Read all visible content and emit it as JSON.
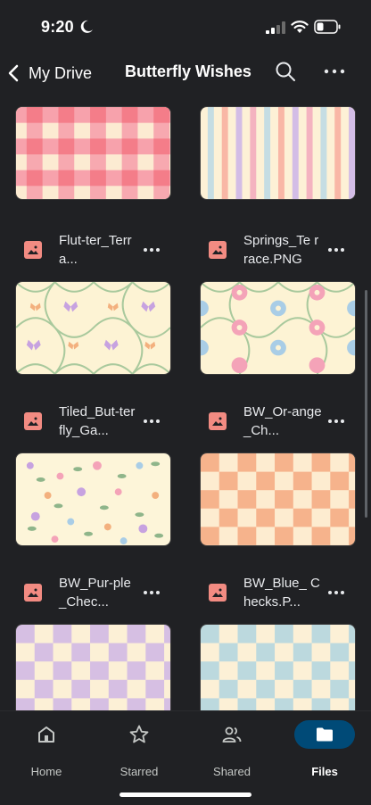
{
  "status": {
    "time": "9:20"
  },
  "header": {
    "back_label": "My Drive",
    "title": "Butterfly Wishes"
  },
  "files": [
    {
      "name": "",
      "pattern": "pink-gingham"
    },
    {
      "name": "",
      "pattern": "pastel-stripes"
    },
    {
      "name": "Flut-ter_Terra...",
      "pattern": "butterfly-trellis"
    },
    {
      "name": "Springs_Te rrace.PNG",
      "pattern": "flower-trellis"
    },
    {
      "name": "Tiled_But-terfly_Ga...",
      "pattern": "floral-scatter"
    },
    {
      "name": "BW_Or-ange_Ch...",
      "pattern": "orange-checks"
    },
    {
      "name": "BW_Pur-ple_Chec...",
      "pattern": "purple-checks"
    },
    {
      "name": "BW_Blue_ Checks.P...",
      "pattern": "blue-checks"
    }
  ],
  "nav": {
    "home": "Home",
    "starred": "Starred",
    "shared": "Shared",
    "files": "Files"
  },
  "colors": {
    "background": "#202124",
    "file_icon": "#f28b82",
    "active_nav": "#004a77"
  }
}
